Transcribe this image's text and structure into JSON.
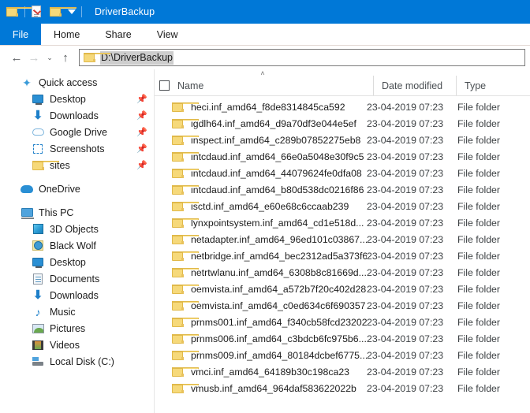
{
  "window": {
    "title": "DriverBackup",
    "titlebar_color": "#0078d7",
    "icons": [
      {
        "name": "folder-icon",
        "glyph": "folder"
      },
      {
        "name": "properties-icon",
        "glyph": "document-check"
      },
      {
        "name": "new-folder-icon",
        "glyph": "folder"
      },
      {
        "name": "customize-toolbar-caret-icon",
        "glyph": "caret-down"
      }
    ]
  },
  "ribbon": {
    "file_tab": "File",
    "tabs": [
      {
        "label": "Home"
      },
      {
        "label": "Share"
      },
      {
        "label": "View"
      }
    ]
  },
  "navbar": {
    "back": "←",
    "forward": "→",
    "recent": "⌄",
    "up": "↑",
    "address_value": "D:\\DriverBackup",
    "address_placeholder": "D:\\DriverBackup",
    "address_selected": true
  },
  "sidebar": {
    "items": [
      {
        "label": "Quick access",
        "icon": "star-icon",
        "level": 0,
        "pin": ""
      },
      {
        "label": "Desktop",
        "icon": "monitor-icon",
        "level": 1,
        "pin": "📌"
      },
      {
        "label": "Downloads",
        "icon": "download-arrow-icon",
        "level": 1,
        "pin": "📌"
      },
      {
        "label": "Google Drive",
        "icon": "cloud-outline-icon",
        "level": 1,
        "pin": "📌"
      },
      {
        "label": "Screenshots",
        "icon": "screenshot-dashed-icon",
        "level": 1,
        "pin": "📌"
      },
      {
        "label": "sites",
        "icon": "folder-icon",
        "level": 1,
        "pin": "📌"
      },
      {
        "label": "OneDrive",
        "icon": "onedrive-cloud-icon",
        "level": 0,
        "pin": ""
      },
      {
        "label": "This PC",
        "icon": "this-pc-icon",
        "level": 0,
        "pin": ""
      },
      {
        "label": "3D Objects",
        "icon": "cube-icon",
        "level": 1,
        "pin": ""
      },
      {
        "label": "Black Wolf",
        "icon": "user-folder-icon",
        "level": 1,
        "pin": ""
      },
      {
        "label": "Desktop",
        "icon": "monitor-icon",
        "level": 1,
        "pin": ""
      },
      {
        "label": "Documents",
        "icon": "documents-icon",
        "level": 1,
        "pin": ""
      },
      {
        "label": "Downloads",
        "icon": "download-arrow-icon",
        "level": 1,
        "pin": ""
      },
      {
        "label": "Music",
        "icon": "music-note-icon",
        "level": 1,
        "pin": ""
      },
      {
        "label": "Pictures",
        "icon": "pictures-icon",
        "level": 1,
        "pin": ""
      },
      {
        "label": "Videos",
        "icon": "videos-icon",
        "level": 1,
        "pin": ""
      },
      {
        "label": "Local Disk (C:)",
        "icon": "local-disk-icon",
        "level": 1,
        "pin": ""
      }
    ]
  },
  "filelist": {
    "select_all_checked": false,
    "sort_indicator": "˄",
    "sort_column": "Name",
    "sort_direction": "ascending",
    "columns": [
      {
        "label": "Name"
      },
      {
        "label": "Date modified"
      },
      {
        "label": "Type"
      }
    ],
    "rows": [
      {
        "name": "heci.inf_amd64_f8de8314845ca592",
        "date": "23-04-2019 07:23",
        "type": "File folder"
      },
      {
        "name": "igdlh64.inf_amd64_d9a70df3e044e5ef",
        "date": "23-04-2019 07:23",
        "type": "File folder"
      },
      {
        "name": "inspect.inf_amd64_c289b07852275eb8",
        "date": "23-04-2019 07:23",
        "type": "File folder"
      },
      {
        "name": "intcdaud.inf_amd64_66e0a5048e30f9c5",
        "date": "23-04-2019 07:23",
        "type": "File folder"
      },
      {
        "name": "intcdaud.inf_amd64_44079624fe0dfa08",
        "date": "23-04-2019 07:23",
        "type": "File folder"
      },
      {
        "name": "intcdaud.inf_amd64_b80d538dc0216f86",
        "date": "23-04-2019 07:23",
        "type": "File folder"
      },
      {
        "name": "isctd.inf_amd64_e60e68c6ccaab239",
        "date": "23-04-2019 07:23",
        "type": "File folder"
      },
      {
        "name": "lynxpointsystem.inf_amd64_cd1e518d...",
        "date": "23-04-2019 07:23",
        "type": "File folder"
      },
      {
        "name": "netadapter.inf_amd64_96ed101c03867...",
        "date": "23-04-2019 07:23",
        "type": "File folder"
      },
      {
        "name": "netbridge.inf_amd64_bec2312ad5a373f6",
        "date": "23-04-2019 07:23",
        "type": "File folder"
      },
      {
        "name": "netrtwlanu.inf_amd64_6308b8c81669d...",
        "date": "23-04-2019 07:23",
        "type": "File folder"
      },
      {
        "name": "oemvista.inf_amd64_a572b7f20c402d28",
        "date": "23-04-2019 07:23",
        "type": "File folder"
      },
      {
        "name": "oemvista.inf_amd64_c0ed634c6f690357",
        "date": "23-04-2019 07:23",
        "type": "File folder"
      },
      {
        "name": "prnms001.inf_amd64_f340cb58fcd23202",
        "date": "23-04-2019 07:23",
        "type": "File folder"
      },
      {
        "name": "prnms006.inf_amd64_c3bdcb6fc975b6...",
        "date": "23-04-2019 07:23",
        "type": "File folder"
      },
      {
        "name": "prnms009.inf_amd64_80184dcbef6775...",
        "date": "23-04-2019 07:23",
        "type": "File folder"
      },
      {
        "name": "vmci.inf_amd64_64189b30c198ca23",
        "date": "23-04-2019 07:23",
        "type": "File folder"
      },
      {
        "name": "vmusb.inf_amd64_964daf583622022b",
        "date": "23-04-2019 07:23",
        "type": "File folder"
      }
    ]
  }
}
